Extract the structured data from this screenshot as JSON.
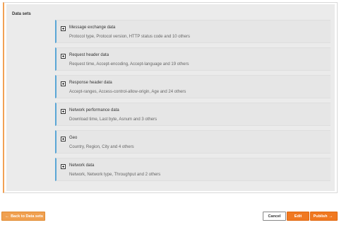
{
  "panel": {
    "title": "Data sets"
  },
  "datasets": [
    {
      "title": "Message exchange data",
      "desc": "Protocol type, Protocol version, HTTP status code and 10 others"
    },
    {
      "title": "Request header data",
      "desc": "Request time, Accept-encoding, Accept-language and 19 others"
    },
    {
      "title": "Response header data",
      "desc": "Accept-ranges, Access-control-allow-origin, Age and 24 others"
    },
    {
      "title": "Network performance data",
      "desc": "Download time, Last byte, Asnum and 3 others"
    },
    {
      "title": "Geo",
      "desc": "Country, Region, City and 4 others"
    },
    {
      "title": "Network data",
      "desc": "Network, Network type, Throughput and 2 others"
    }
  ],
  "footer": {
    "back_label": "Back to Data sets",
    "cancel_label": "Cancel",
    "edit_label": "Edit",
    "publish_label": "Publish"
  },
  "icons": {
    "expand": "plus-square-icon",
    "back": "arrow-left-icon",
    "publish": "arrow-right-icon"
  },
  "colors": {
    "accent": "#f07820",
    "panel_border": "#f2a154",
    "item_border": "#5aa6d6"
  }
}
